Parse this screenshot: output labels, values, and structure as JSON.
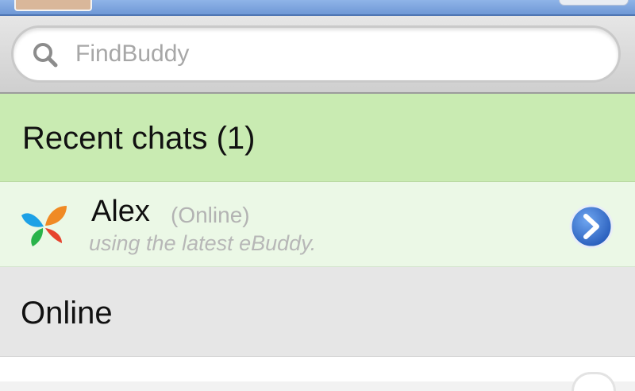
{
  "search": {
    "placeholder": "FindBuddy"
  },
  "sections": {
    "recent": {
      "title": "Recent chats (1)"
    },
    "online": {
      "title": "Online"
    }
  },
  "contacts": [
    {
      "name": "Alex",
      "status": "(Online)",
      "message": "using the latest eBuddy."
    }
  ],
  "icons": {
    "search": "search-icon",
    "avatar": "msn-butterfly-icon",
    "open_chat": "chevron-right-icon"
  },
  "colors": {
    "header_blue": "#6f98d6",
    "recent_section_bg": "#c9ebb2",
    "contact_row_bg": "#ebf8e6",
    "online_section_bg": "#e6e6e6",
    "chevron_blue": "#2e6fd1"
  }
}
